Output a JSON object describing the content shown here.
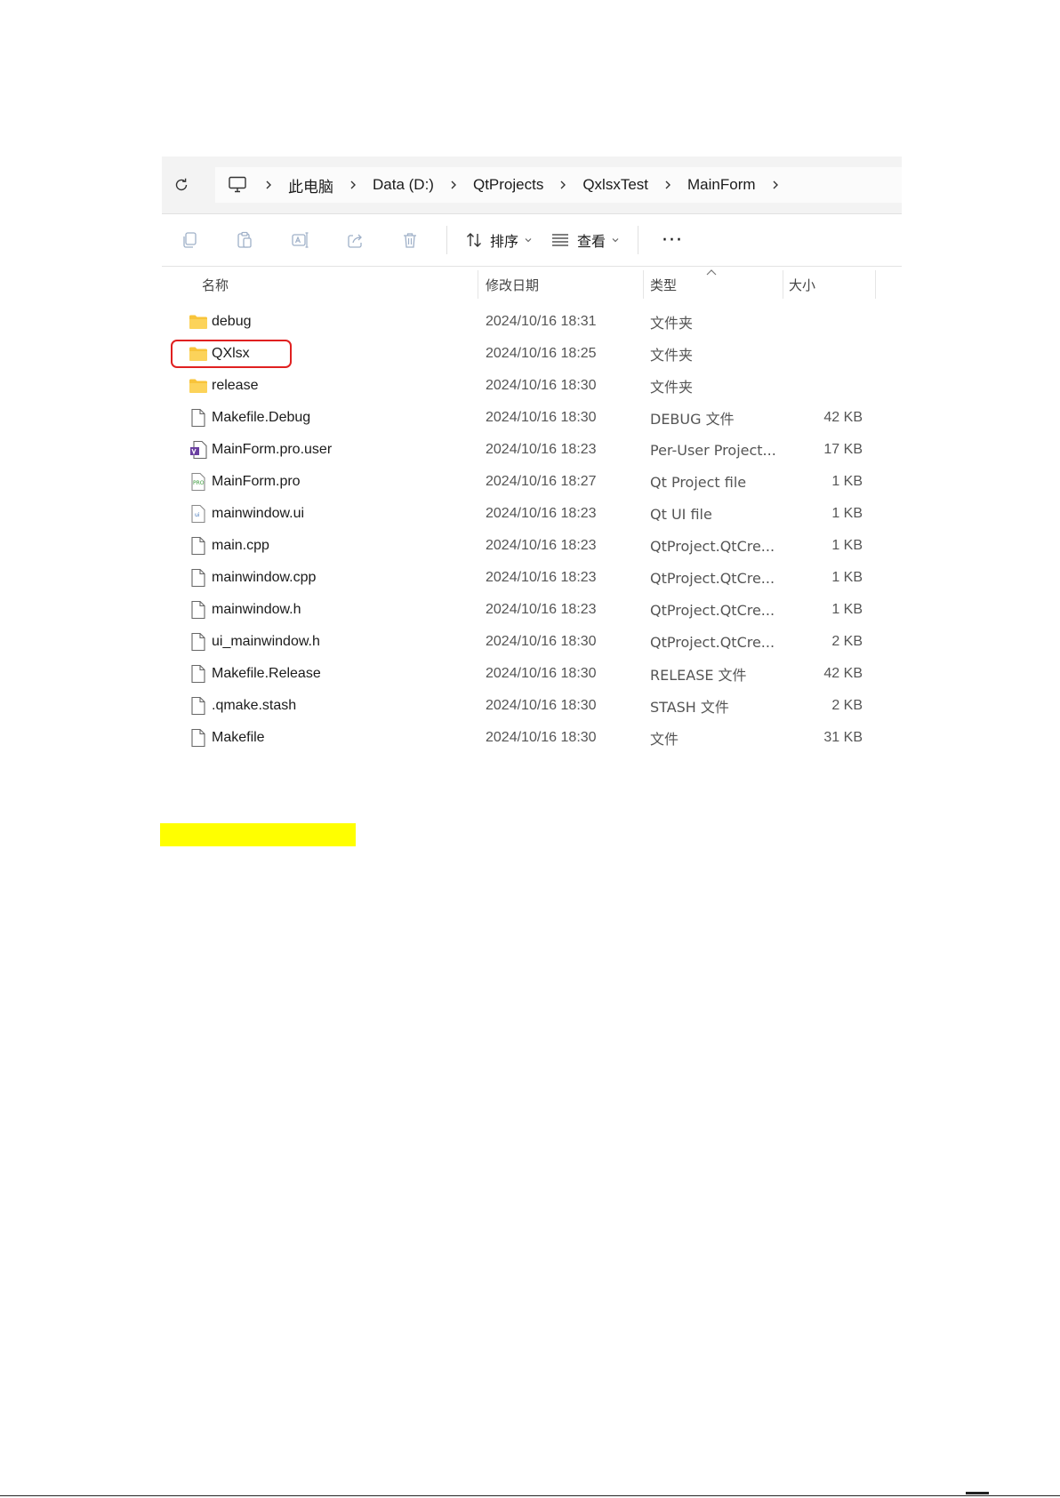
{
  "breadcrumb": [
    "此电脑",
    "Data (D:)",
    "QtProjects",
    "QxlsxTest",
    "MainForm"
  ],
  "toolbar": {
    "sort_label": "排序",
    "view_label": "查看",
    "more_label": "···"
  },
  "columns": {
    "name": "名称",
    "date": "修改日期",
    "type": "类型",
    "size": "大小"
  },
  "files": [
    {
      "name": "debug",
      "date": "2024/10/16 18:31",
      "type": "文件夹",
      "size": "",
      "icon": "folder-icon"
    },
    {
      "name": "QXlsx",
      "date": "2024/10/16 18:25",
      "type": "文件夹",
      "size": "",
      "icon": "folder-icon",
      "highlighted": true
    },
    {
      "name": "release",
      "date": "2024/10/16 18:30",
      "type": "文件夹",
      "size": "",
      "icon": "folder-icon"
    },
    {
      "name": "Makefile.Debug",
      "date": "2024/10/16 18:30",
      "type": "DEBUG 文件",
      "size": "42 KB",
      "icon": "file-icon"
    },
    {
      "name": "MainForm.pro.user",
      "date": "2024/10/16 18:23",
      "type": "Per-User Project...",
      "size": "17 KB",
      "icon": "vs-file-icon"
    },
    {
      "name": "MainForm.pro",
      "date": "2024/10/16 18:27",
      "type": "Qt Project file",
      "size": "1 KB",
      "icon": "pro-file-icon"
    },
    {
      "name": "mainwindow.ui",
      "date": "2024/10/16 18:23",
      "type": "Qt UI file",
      "size": "1 KB",
      "icon": "ui-file-icon"
    },
    {
      "name": "main.cpp",
      "date": "2024/10/16 18:23",
      "type": "QtProject.QtCre...",
      "size": "1 KB",
      "icon": "file-icon"
    },
    {
      "name": "mainwindow.cpp",
      "date": "2024/10/16 18:23",
      "type": "QtProject.QtCre...",
      "size": "1 KB",
      "icon": "file-icon"
    },
    {
      "name": "mainwindow.h",
      "date": "2024/10/16 18:23",
      "type": "QtProject.QtCre...",
      "size": "1 KB",
      "icon": "file-icon"
    },
    {
      "name": "ui_mainwindow.h",
      "date": "2024/10/16 18:30",
      "type": "QtProject.QtCre...",
      "size": "2 KB",
      "icon": "file-icon"
    },
    {
      "name": "Makefile.Release",
      "date": "2024/10/16 18:30",
      "type": "RELEASE 文件",
      "size": "42 KB",
      "icon": "file-icon"
    },
    {
      "name": ".qmake.stash",
      "date": "2024/10/16 18:30",
      "type": "STASH 文件",
      "size": "2 KB",
      "icon": "file-icon"
    },
    {
      "name": "Makefile",
      "date": "2024/10/16 18:30",
      "type": "文件",
      "size": "31 KB",
      "icon": "file-icon"
    }
  ],
  "colors": {
    "highlight_border": "#e02020",
    "folder": "#f8c43a",
    "yellow_bar": "#ffff00"
  }
}
